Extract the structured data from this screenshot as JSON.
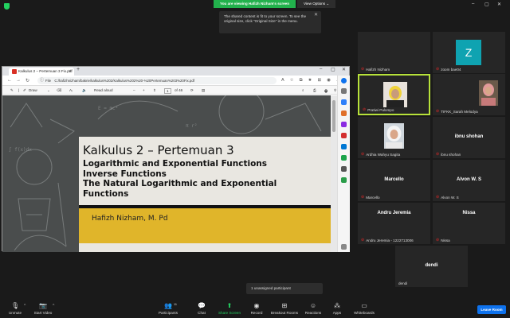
{
  "banner": {
    "text": "You are viewing Hafizh Nizham's screen",
    "view_options": "View Options"
  },
  "tooltip": {
    "text": "The shared content is fit to your screen. To see the original size, click \"Original Size\" in the menu."
  },
  "browser": {
    "tab_title": "Kalkulus 2 – Pertemuan 3 Fix.pdf",
    "url_prefix": "File",
    "url": "C:/hafizhnizham/bakrie/kalkulus%202/Kalkulus%202%20-%20Pertemuan%203%20Fix.pdf",
    "toolbar": {
      "draw": "Draw",
      "read_aloud": "Read aloud",
      "page": "1",
      "of_pages": "of 46"
    }
  },
  "slide": {
    "title": "Kalkulus 2 – Pertemuan 3",
    "subtitle_lines": [
      "Logarithmic and Exponential Functions",
      "Inverse Functions",
      "The Natural Logarithmic and Exponential",
      "Functions"
    ],
    "author": "Hafizh Nizham, M. Pd"
  },
  "participants": [
    {
      "name": "Hafizh Nizham"
    },
    {
      "name": "zoom bae04",
      "initial": "Z"
    },
    {
      "name": "Pratiwi Palompo"
    },
    {
      "name": "TIFKK_Sarah Melodya"
    },
    {
      "name": "Ardhia Wahyu Sagita"
    },
    {
      "name": "ibnu shohan",
      "label": "ibnu shohan"
    },
    {
      "name": "Marcello",
      "label": "Marcello"
    },
    {
      "name": "Alvon W. S",
      "label": "Alvon W. S"
    },
    {
      "name": "Andru Jeremia - 1222713006",
      "label": "Andru Jeremia"
    },
    {
      "name": "Nissa",
      "label": "Nissa"
    },
    {
      "name": "dendi",
      "label": "dendi"
    }
  ],
  "unassigned": "1 unassigned participant",
  "toolbar": {
    "unmute": "Unmute",
    "start_video": "Start Video",
    "participants": "Participants",
    "participants_count": "11",
    "chat": "Chat",
    "share_screen": "Share Screen",
    "record": "Record",
    "breakout": "Breakout Rooms",
    "reactions": "Reactions",
    "apps": "Apps",
    "whiteboards": "Whiteboards",
    "leave": "Leave Room"
  },
  "colors": {
    "accent_green": "#23d160",
    "zoom_blue": "#0e72ed",
    "active_border": "#b7e23a",
    "slide_yellow": "#e0b52a"
  }
}
